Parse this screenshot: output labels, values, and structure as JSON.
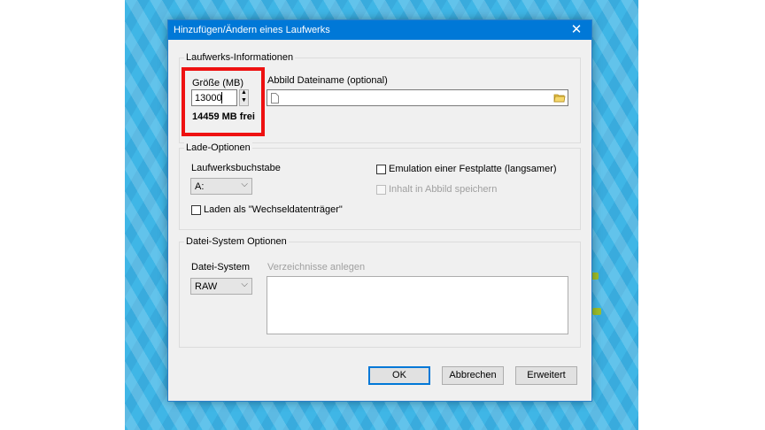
{
  "dialog": {
    "title": "Hinzufügen/Ändern eines Laufwerks",
    "close_glyph": "✕"
  },
  "drive_info": {
    "legend": "Laufwerks-Informationen",
    "size_label": "Größe (MB)",
    "size_value": "13000",
    "free_text": "14459 MB frei",
    "image_label": "Abbild Dateiname (optional)",
    "image_value": "",
    "file_icon": "file-icon",
    "folder_icon": "folder-icon"
  },
  "load_options": {
    "legend": "Lade-Optionen",
    "drive_letter_label": "Laufwerksbuchstabe",
    "drive_letter_value": "A:",
    "removable_label": "Laden als \"Wechseldatenträger\"",
    "emulation_label": "Emulation einer Festplatte (langsamer)",
    "store_in_image_label": "Inhalt in Abbild speichern"
  },
  "fs_options": {
    "legend": "Datei-System Optionen",
    "fs_label": "Datei-System",
    "fs_value": "RAW",
    "create_dirs_label": "Verzeichnisse anlegen"
  },
  "buttons": {
    "ok": "OK",
    "cancel": "Abbrechen",
    "advanced": "Erweitert"
  },
  "colors": {
    "highlight": "#ee1111",
    "accent": "#0078d7"
  }
}
